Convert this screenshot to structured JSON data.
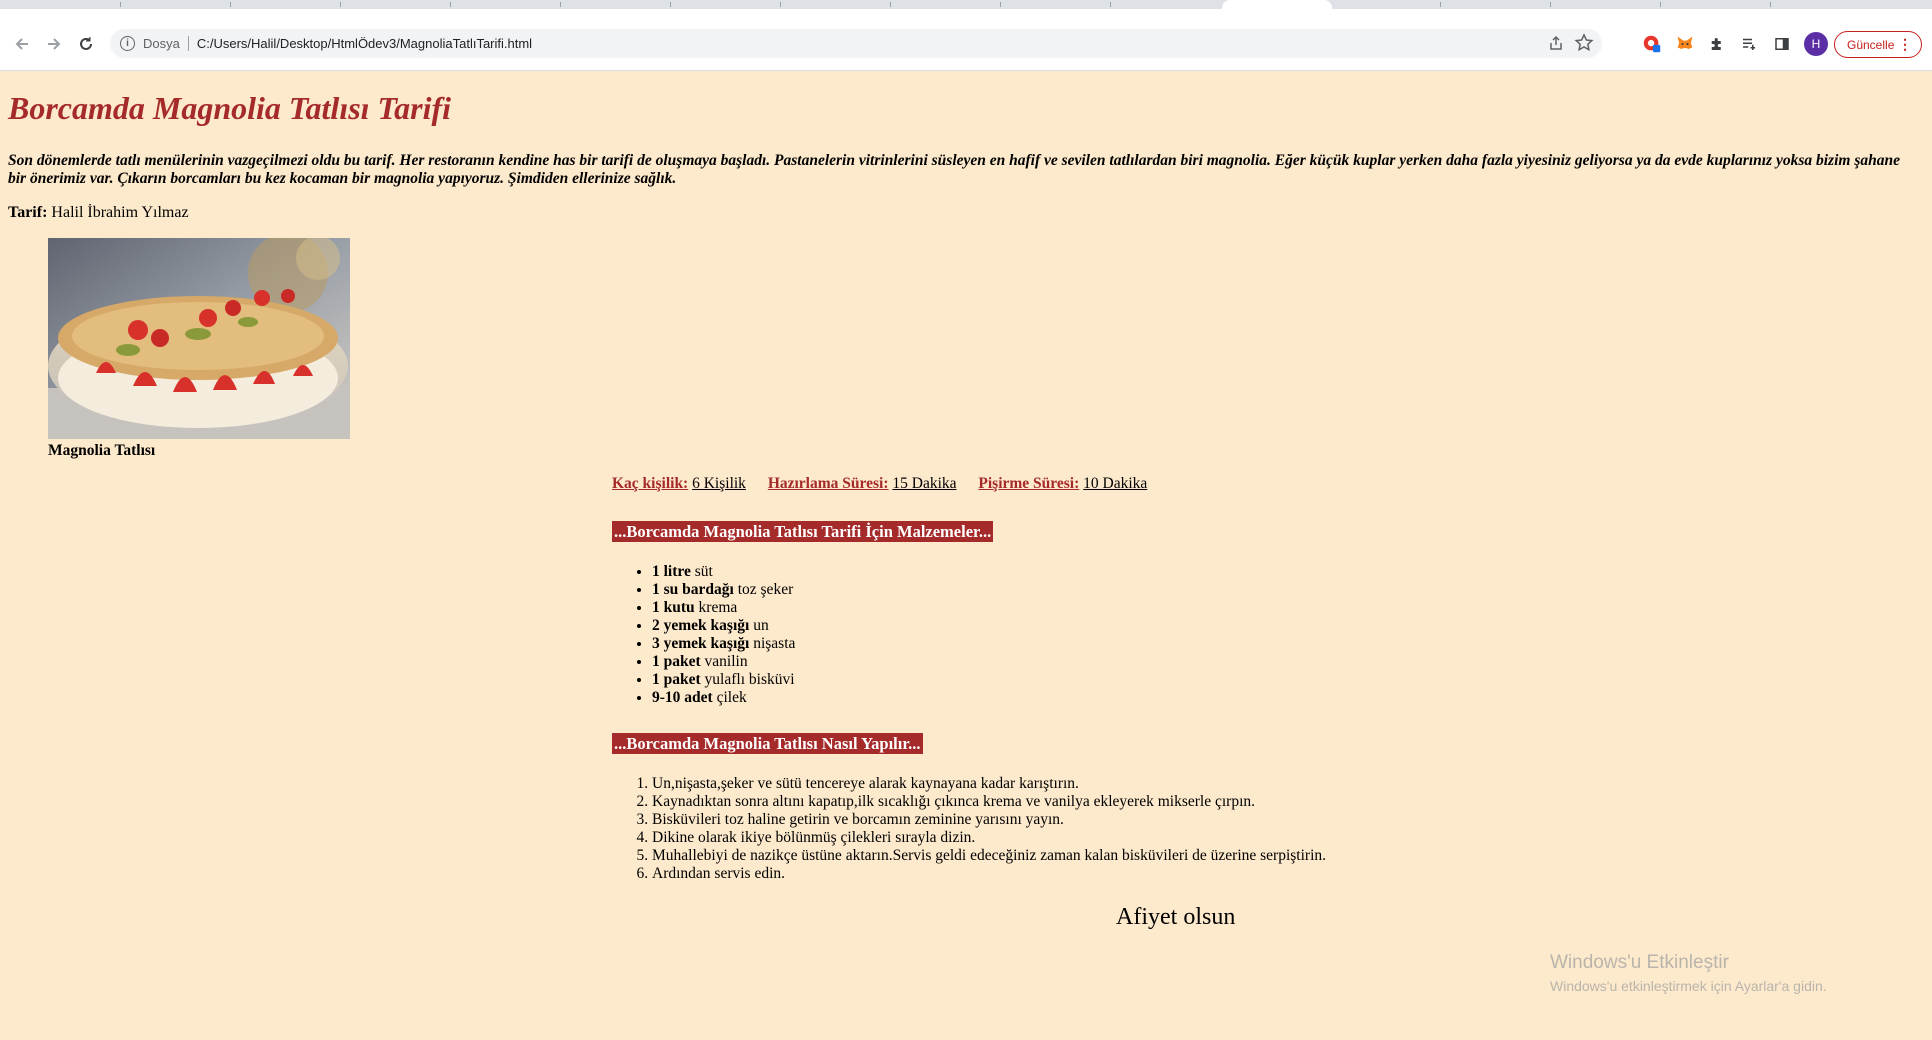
{
  "browser": {
    "address": {
      "scheme_label": "Dosya",
      "url": "C:/Users/Halil/Desktop/HtmlÖdev3/MagnoliaTatlıTarifi.html"
    },
    "profile_initial": "H",
    "update_label": "Güncelle",
    "icons": [
      "back-arrow-icon",
      "forward-arrow-icon",
      "reload-icon",
      "info-icon",
      "share-icon",
      "star-icon",
      "extension-red-icon",
      "metamask-fox-icon",
      "puzzle-icon",
      "reading-list-icon",
      "sidebar-icon",
      "menu-dots-icon"
    ]
  },
  "page": {
    "title": "Borcamda Magnolia Tatlısı Tarifi",
    "intro": "Son dönemlerde tatlı menülerinin vazgeçilmezi oldu bu tarif. Her restoranın kendine has bir tarifi de oluşmaya başladı. Pastanelerin vitrinlerini süsleyen en hafif ve sevilen tatlılardan biri magnolia. Eğer küçük kuplar yerken daha fazla yiyesiniz geliyorsa ya da evde kuplarınız yoksa bizim şahane bir önerimiz var. Çıkarın borcamları bu kez kocaman bir magnolia yapıyoruz. Şimdiden ellerinize sağlık.",
    "author_label": "Tarif:",
    "author_name": "Halil İbrahim Yılmaz",
    "photo_caption": "Magnolia Tatlısı",
    "stats": {
      "serves_label": "Kaç kişilik:",
      "serves_value": "6 Kişilik",
      "prep_label": "Hazırlama Süresi:",
      "prep_value": "15 Dakika",
      "cook_label": "Pişirme Süresi:",
      "cook_value": "10 Dakika"
    },
    "ingredients_heading": "...Borcamda Magnolia Tatlısı Tarifi İçin Malzemeler...",
    "ingredients": [
      {
        "qty": "1 litre",
        "name": "süt"
      },
      {
        "qty": "1 su bardağı",
        "name": "toz şeker"
      },
      {
        "qty": "1 kutu",
        "name": "krema"
      },
      {
        "qty": "2 yemek kaşığı",
        "name": "un"
      },
      {
        "qty": "3 yemek kaşığı",
        "name": "nişasta"
      },
      {
        "qty": "1 paket",
        "name": "vanilin"
      },
      {
        "qty": "1 paket",
        "name": "yulaflı bisküvi"
      },
      {
        "qty": "9-10 adet",
        "name": "çilek"
      }
    ],
    "method_heading": "...Borcamda Magnolia Tatlısı Nasıl Yapılır...",
    "steps": [
      "Un,nişasta,şeker ve sütü tencereye alarak kaynayana kadar karıştırın.",
      "Kaynadıktan sonra altını kapatıp,ilk sıcaklığı çıkınca krema ve vanilya ekleyerek mikserle çırpın.",
      "Bisküvileri toz haline getirin ve borcamın zeminine yarısını yayın.",
      "Dikine olarak ikiye bölünmüş çilekleri sırayla dizin.",
      "Muhallebiyi de nazikçe üstüne aktarın.Servis geldi edeceğiniz zaman kalan bisküvileri de üzerine serpiştirin.",
      "Ardından servis edin."
    ],
    "closing": "Afiyet olsun"
  },
  "watermark": {
    "line1": "Windows'u Etkinleştir",
    "line2": "Windows'u etkinleştirmek için Ayarlar'a gidin."
  },
  "colors": {
    "page_background": "#fde9cb",
    "accent": "#a52a2a",
    "heading_text": "#ffffff"
  }
}
